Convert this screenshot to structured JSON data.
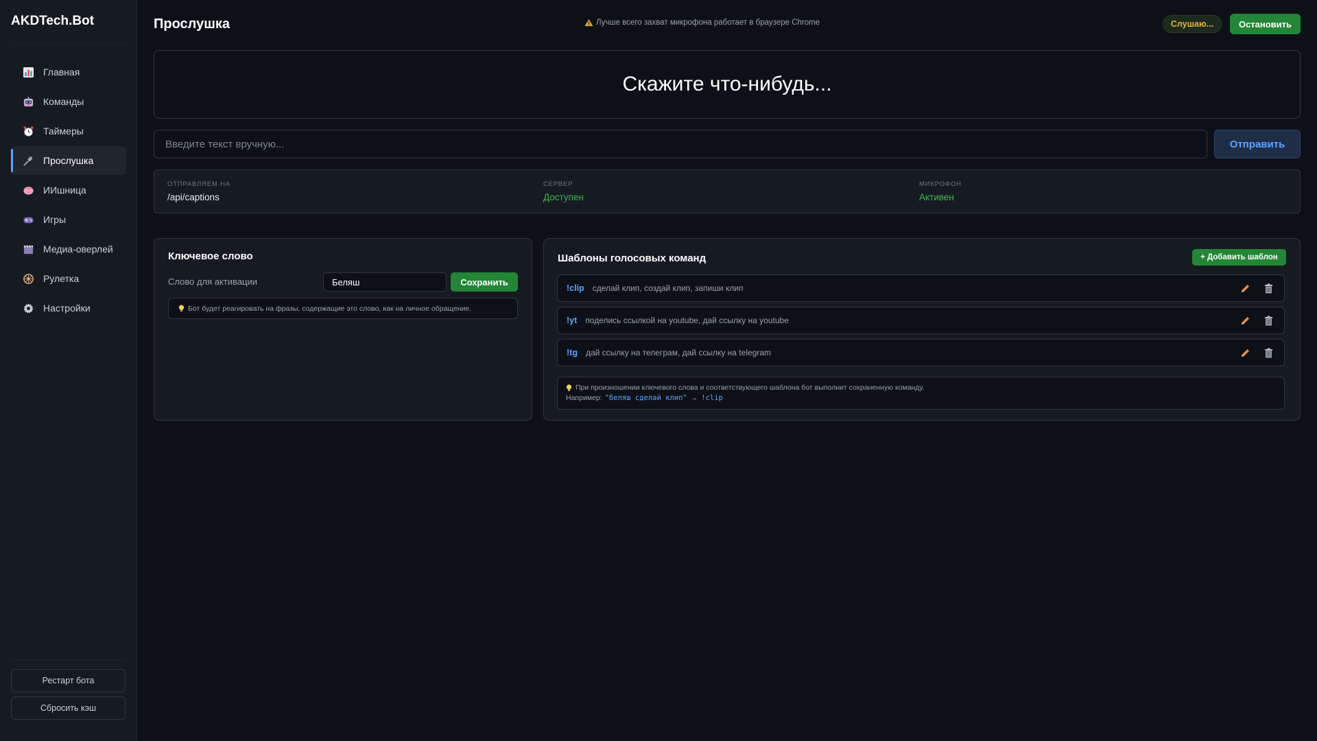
{
  "sidebar": {
    "brand": "AKDTech.Bot",
    "items": [
      {
        "label": "Главная",
        "icon": "chart-icon",
        "active": false
      },
      {
        "label": "Команды",
        "icon": "robot-icon",
        "active": false
      },
      {
        "label": "Таймеры",
        "icon": "alarm-clock-icon",
        "active": false
      },
      {
        "label": "Прослушка",
        "icon": "microphone-icon",
        "active": true
      },
      {
        "label": "ИИшница",
        "icon": "brain-icon",
        "active": false
      },
      {
        "label": "Игры",
        "icon": "gamepad-icon",
        "active": false
      },
      {
        "label": "Медиа-оверлей",
        "icon": "clapperboard-icon",
        "active": false
      },
      {
        "label": "Рулетка",
        "icon": "wheel-icon",
        "active": false
      },
      {
        "label": "Настройки",
        "icon": "gear-icon",
        "active": false
      }
    ],
    "restart_label": "Рестарт бота",
    "reset_cache_label": "Сбросить кэш"
  },
  "header": {
    "title": "Прослушка",
    "notice": "Лучше всего захват микрофона работает в браузере Chrome",
    "listening_label": "Слушаю...",
    "stop_label": "Остановить"
  },
  "transcript": {
    "text": "Скажите что-нибудь..."
  },
  "manual": {
    "placeholder": "Введите текст вручную...",
    "value": "",
    "send_label": "Отправить"
  },
  "status": {
    "target_label": "Отправляем на",
    "target_value": "/api/captions",
    "server_label": "Сервер",
    "server_value": "Доступен",
    "mic_label": "Микрофон",
    "mic_value": "Активен"
  },
  "keyword": {
    "title": "Ключевое слово",
    "field_label": "Слово для активации",
    "value": "Беляш",
    "save_label": "Сохранить",
    "hint": "Бот будет реагировать на фразы, содержащие это слово, как на личное обращение."
  },
  "templates": {
    "title": "Шаблоны голосовых команд",
    "add_label": "+ Добавить шаблон",
    "items": [
      {
        "command": "!clip",
        "phrases": "сделай клип, создай клип, запиши клип"
      },
      {
        "command": "!yt",
        "phrases": "поделись ссылкой на youtube, дай ссылку на youtube"
      },
      {
        "command": "!tg",
        "phrases": "дай ссылку на телеграм, дай ссылку на telegram"
      }
    ],
    "hint_line1": "При произношении ключевого слова и соответствующего шаблона бот выполнит сохраненную команду.",
    "hint_example_prefix": "Например:",
    "hint_example_phrase": "\"беляш сделай клип\"",
    "hint_example_arrow": "→",
    "hint_example_command": "!clip"
  },
  "colors": {
    "background": "#0d1117",
    "panel": "#161b22",
    "border": "#30363d",
    "accent_blue": "#58a6ff",
    "accent_green": "#238636",
    "status_green": "#3fb950",
    "warning_yellow": "#e3b341",
    "edit_orange": "#f0883e"
  }
}
